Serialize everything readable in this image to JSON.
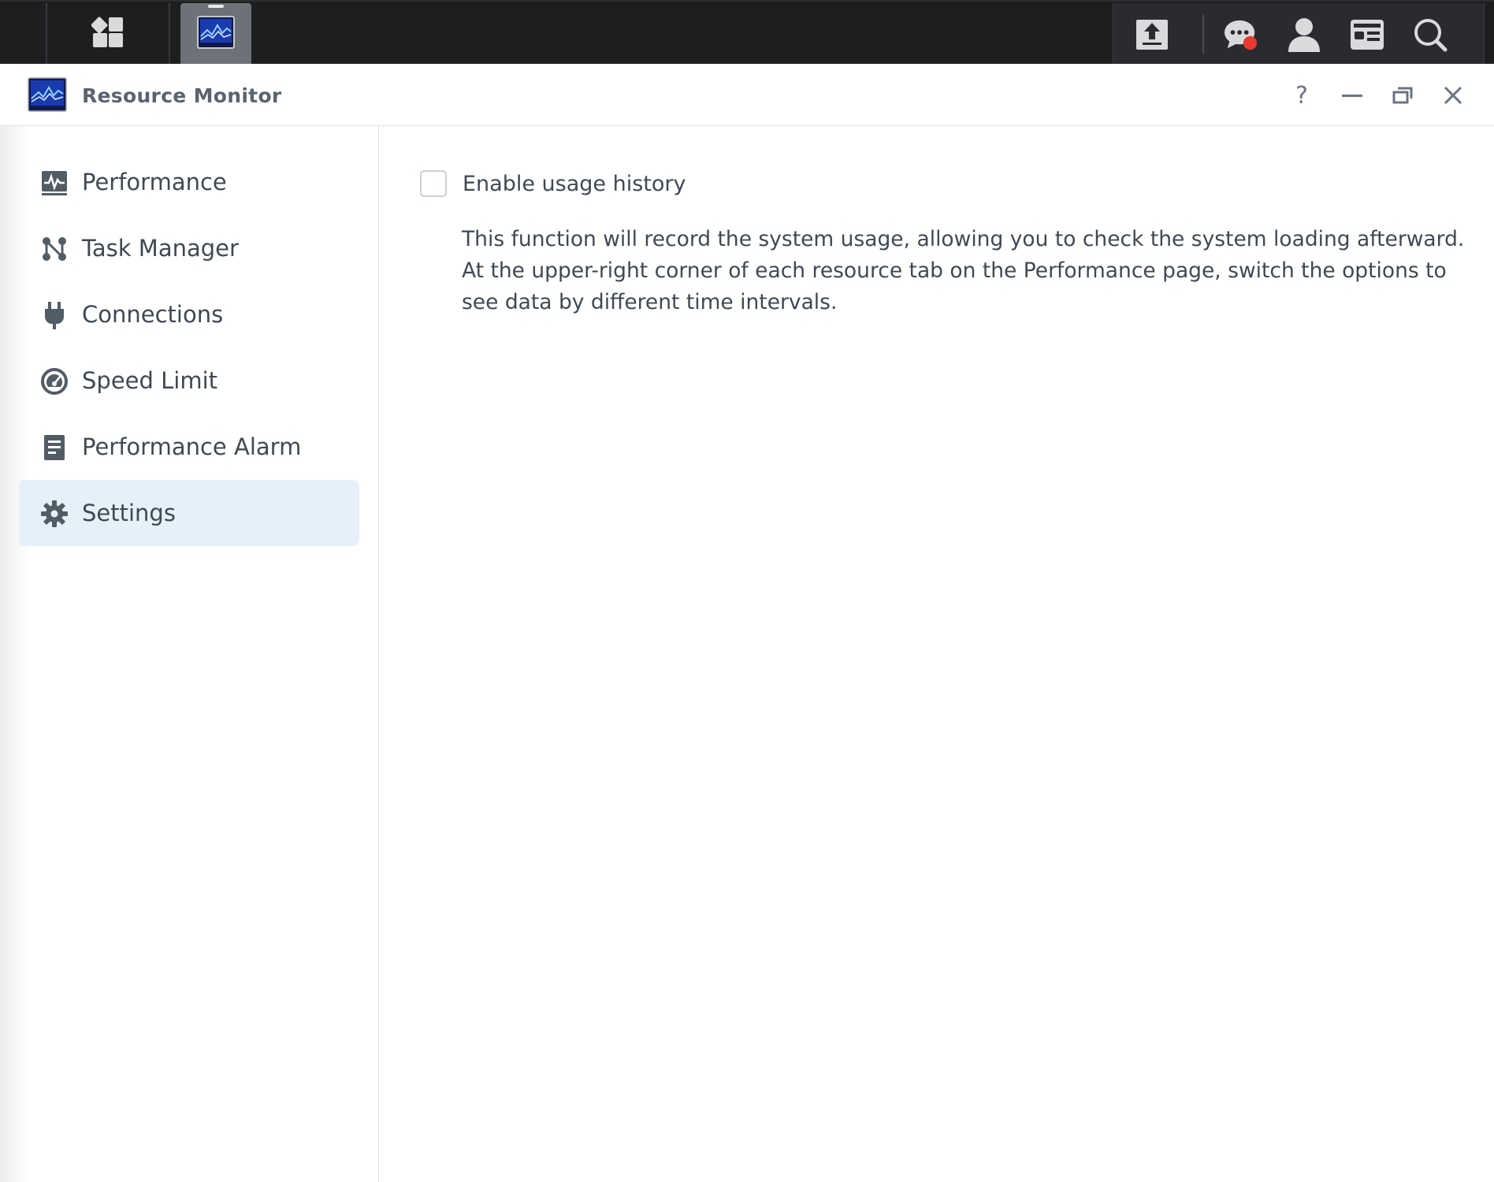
{
  "taskbar": {
    "icons": [
      "main-menu-icon",
      "resource-monitor-icon",
      "upload-icon",
      "chat-icon",
      "user-icon",
      "widgets-icon",
      "search-icon"
    ],
    "notification_color": "#e8392f"
  },
  "window": {
    "title": "Resource Monitor",
    "controls": [
      "help-icon",
      "minimize-icon",
      "restore-icon",
      "close-icon"
    ]
  },
  "sidebar": {
    "items": [
      {
        "label": "Performance",
        "icon": "performance-icon"
      },
      {
        "label": "Task Manager",
        "icon": "task-manager-icon"
      },
      {
        "label": "Connections",
        "icon": "plug-icon"
      },
      {
        "label": "Speed Limit",
        "icon": "speedometer-icon"
      },
      {
        "label": "Performance Alarm",
        "icon": "alarm-document-icon"
      },
      {
        "label": "Settings",
        "icon": "gear-icon",
        "active": true
      }
    ],
    "active_color": "#e6f0fa"
  },
  "settings": {
    "usage_history_label": "Enable usage history",
    "usage_history_checked": false,
    "description_lines": [
      "This function will record the system usage, allowing you to check the system loading afterward.",
      "At the upper-right corner of each resource tab on the Performance page, switch the options to",
      "see data by different time intervals."
    ]
  }
}
